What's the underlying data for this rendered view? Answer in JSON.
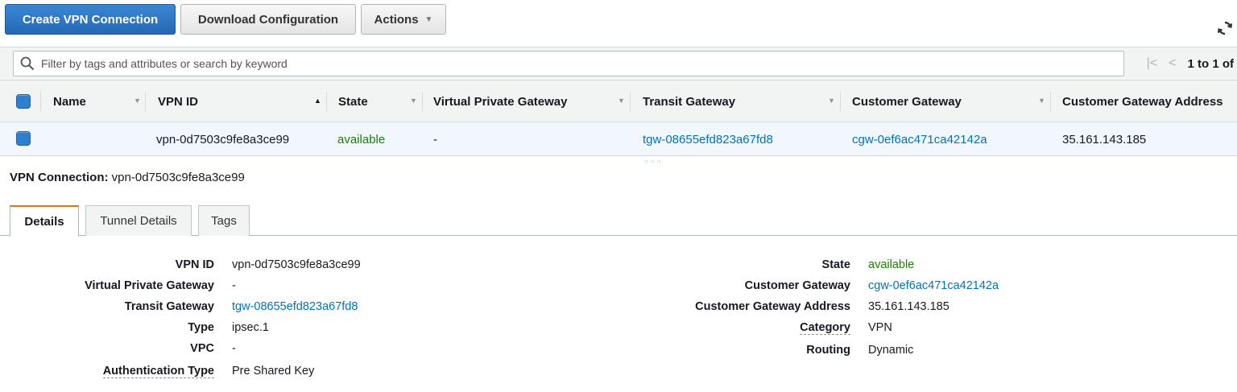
{
  "toolbar": {
    "create_label": "Create VPN Connection",
    "download_label": "Download Configuration",
    "actions_label": "Actions"
  },
  "filter": {
    "placeholder": "Filter by tags and attributes or search by keyword",
    "pagination": "1 to 1 of"
  },
  "table": {
    "columns": [
      "Name",
      "VPN ID",
      "State",
      "Virtual Private Gateway",
      "Transit Gateway",
      "Customer Gateway",
      "Customer Gateway Address"
    ],
    "row": {
      "name": "",
      "vpn_id": "vpn-0d7503c9fe8a3ce99",
      "state": "available",
      "vpg": "-",
      "transit_gateway": "tgw-08655efd823a67fd8",
      "customer_gateway": "cgw-0ef6ac471ca42142a",
      "customer_gateway_address": "35.161.143.185"
    }
  },
  "detail": {
    "title_label": "VPN Connection:",
    "title_value": "vpn-0d7503c9fe8a3ce99",
    "tabs": [
      "Details",
      "Tunnel Details",
      "Tags"
    ],
    "left": [
      {
        "key": "VPN ID",
        "value": "vpn-0d7503c9fe8a3ce99"
      },
      {
        "key": "Virtual Private Gateway",
        "value": "-"
      },
      {
        "key": "Transit Gateway",
        "value": "tgw-08655efd823a67fd8"
      },
      {
        "key": "Type",
        "value": "ipsec.1"
      },
      {
        "key": "VPC",
        "value": "-"
      },
      {
        "key": "Authentication Type",
        "value": "Pre Shared Key"
      }
    ],
    "right": [
      {
        "key": "State",
        "value": "available"
      },
      {
        "key": "Customer Gateway",
        "value": "cgw-0ef6ac471ca42142a"
      },
      {
        "key": "Customer Gateway Address",
        "value": "35.161.143.185"
      },
      {
        "key": "Category",
        "value": "VPN"
      },
      {
        "key": "Routing",
        "value": "Dynamic"
      }
    ]
  },
  "colors": {
    "primary": "#2568b5",
    "link": "#0073bb",
    "status_green": "#1d8102",
    "active_tab_accent": "#ec7211"
  },
  "icons": [
    "search-icon",
    "refresh-icon",
    "first-page-icon",
    "previous-page-icon",
    "sort-caret-icon",
    "chevron-down-icon"
  ]
}
